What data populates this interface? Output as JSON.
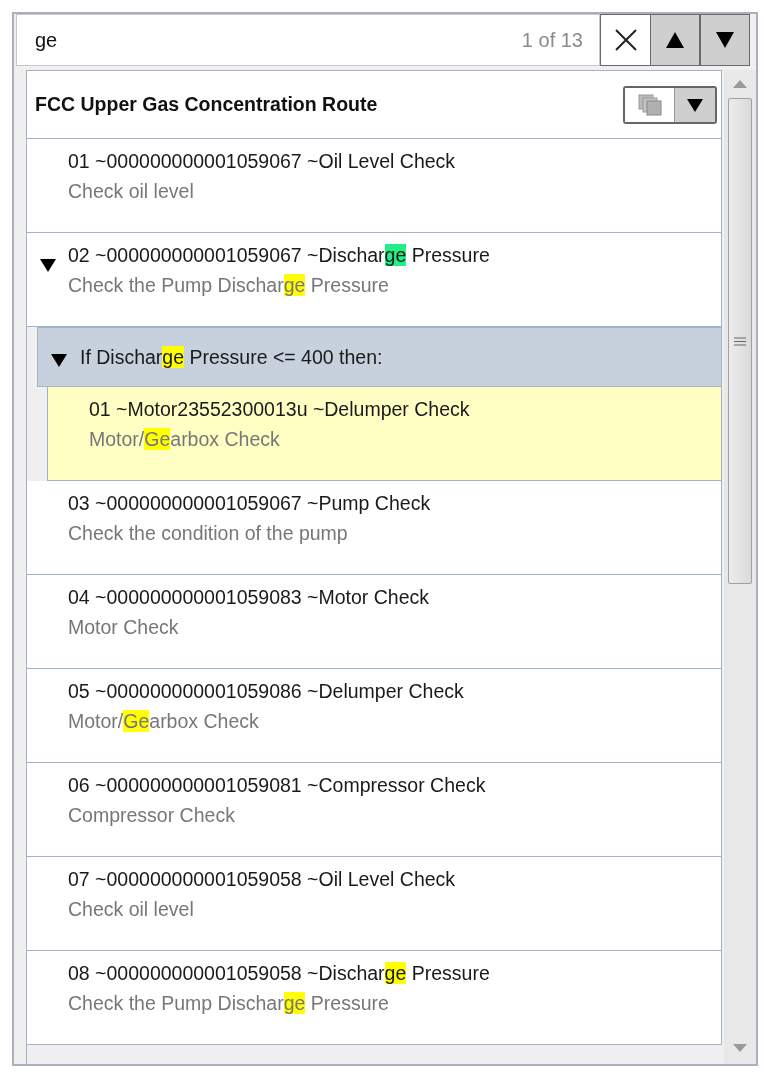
{
  "search": {
    "value": "ge",
    "counter": "1 of 13"
  },
  "route": {
    "title": "FCC Upper Gas Concentration Route",
    "items": [
      {
        "kind": "step",
        "selected": false,
        "title": [
          {
            "text": "01 ~000000000001059067 ~Oil Level Check",
            "match": false,
            "current": false
          }
        ],
        "subtitle": [
          {
            "text": "Check oil level",
            "match": false,
            "current": false
          }
        ]
      },
      {
        "kind": "step",
        "selected": false,
        "expanded": true,
        "title": [
          {
            "text": "02 ~000000000001059067 ~Dischar",
            "match": false,
            "current": false
          },
          {
            "text": "ge",
            "match": true,
            "current": true
          },
          {
            "text": " Pressure",
            "match": false,
            "current": false
          }
        ],
        "subtitle": [
          {
            "text": "Check the Pump Dischar",
            "match": false,
            "current": false
          },
          {
            "text": "ge",
            "match": true,
            "current": false
          },
          {
            "text": " Pressure",
            "match": false,
            "current": false
          }
        ],
        "children": [
          {
            "kind": "condition",
            "expanded": true,
            "title": [
              {
                "text": "If Dischar",
                "match": false,
                "current": false
              },
              {
                "text": "ge",
                "match": true,
                "current": false
              },
              {
                "text": " Pressure <= 400 then:",
                "match": false,
                "current": false
              }
            ],
            "children": [
              {
                "kind": "step",
                "selected": true,
                "title": [
                  {
                    "text": "01 ~Motor23552300013u ~Delumper Check",
                    "match": false,
                    "current": false
                  }
                ],
                "subtitle": [
                  {
                    "text": "Motor/",
                    "match": false,
                    "current": false
                  },
                  {
                    "text": "Ge",
                    "match": true,
                    "current": false
                  },
                  {
                    "text": "arbox Check",
                    "match": false,
                    "current": false
                  }
                ]
              }
            ]
          }
        ]
      },
      {
        "kind": "step",
        "selected": false,
        "title": [
          {
            "text": "03 ~000000000001059067 ~Pump Check",
            "match": false,
            "current": false
          }
        ],
        "subtitle": [
          {
            "text": "Check the condition of the pump",
            "match": false,
            "current": false
          }
        ]
      },
      {
        "kind": "step",
        "selected": false,
        "title": [
          {
            "text": "04 ~000000000001059083 ~Motor Check",
            "match": false,
            "current": false
          }
        ],
        "subtitle": [
          {
            "text": "Motor Check",
            "match": false,
            "current": false
          }
        ]
      },
      {
        "kind": "step",
        "selected": false,
        "title": [
          {
            "text": "05 ~000000000001059086 ~Delumper Check",
            "match": false,
            "current": false
          }
        ],
        "subtitle": [
          {
            "text": "Motor/",
            "match": false,
            "current": false
          },
          {
            "text": "Ge",
            "match": true,
            "current": false
          },
          {
            "text": "arbox Check",
            "match": false,
            "current": false
          }
        ]
      },
      {
        "kind": "step",
        "selected": false,
        "title": [
          {
            "text": "06 ~000000000001059081 ~Compressor Check",
            "match": false,
            "current": false
          }
        ],
        "subtitle": [
          {
            "text": "Compressor Check",
            "match": false,
            "current": false
          }
        ]
      },
      {
        "kind": "step",
        "selected": false,
        "title": [
          {
            "text": "07 ~000000000001059058 ~Oil Level Check",
            "match": false,
            "current": false
          }
        ],
        "subtitle": [
          {
            "text": "Check oil level",
            "match": false,
            "current": false
          }
        ]
      },
      {
        "kind": "step",
        "selected": false,
        "title": [
          {
            "text": "08 ~000000000001059058 ~Dischar",
            "match": false,
            "current": false
          },
          {
            "text": "ge",
            "match": true,
            "current": false
          },
          {
            "text": " Pressure",
            "match": false,
            "current": false
          }
        ],
        "subtitle": [
          {
            "text": "Check the Pump Dischar",
            "match": false,
            "current": false
          },
          {
            "text": "ge",
            "match": true,
            "current": false
          },
          {
            "text": " Pressure",
            "match": false,
            "current": false
          }
        ]
      }
    ]
  }
}
